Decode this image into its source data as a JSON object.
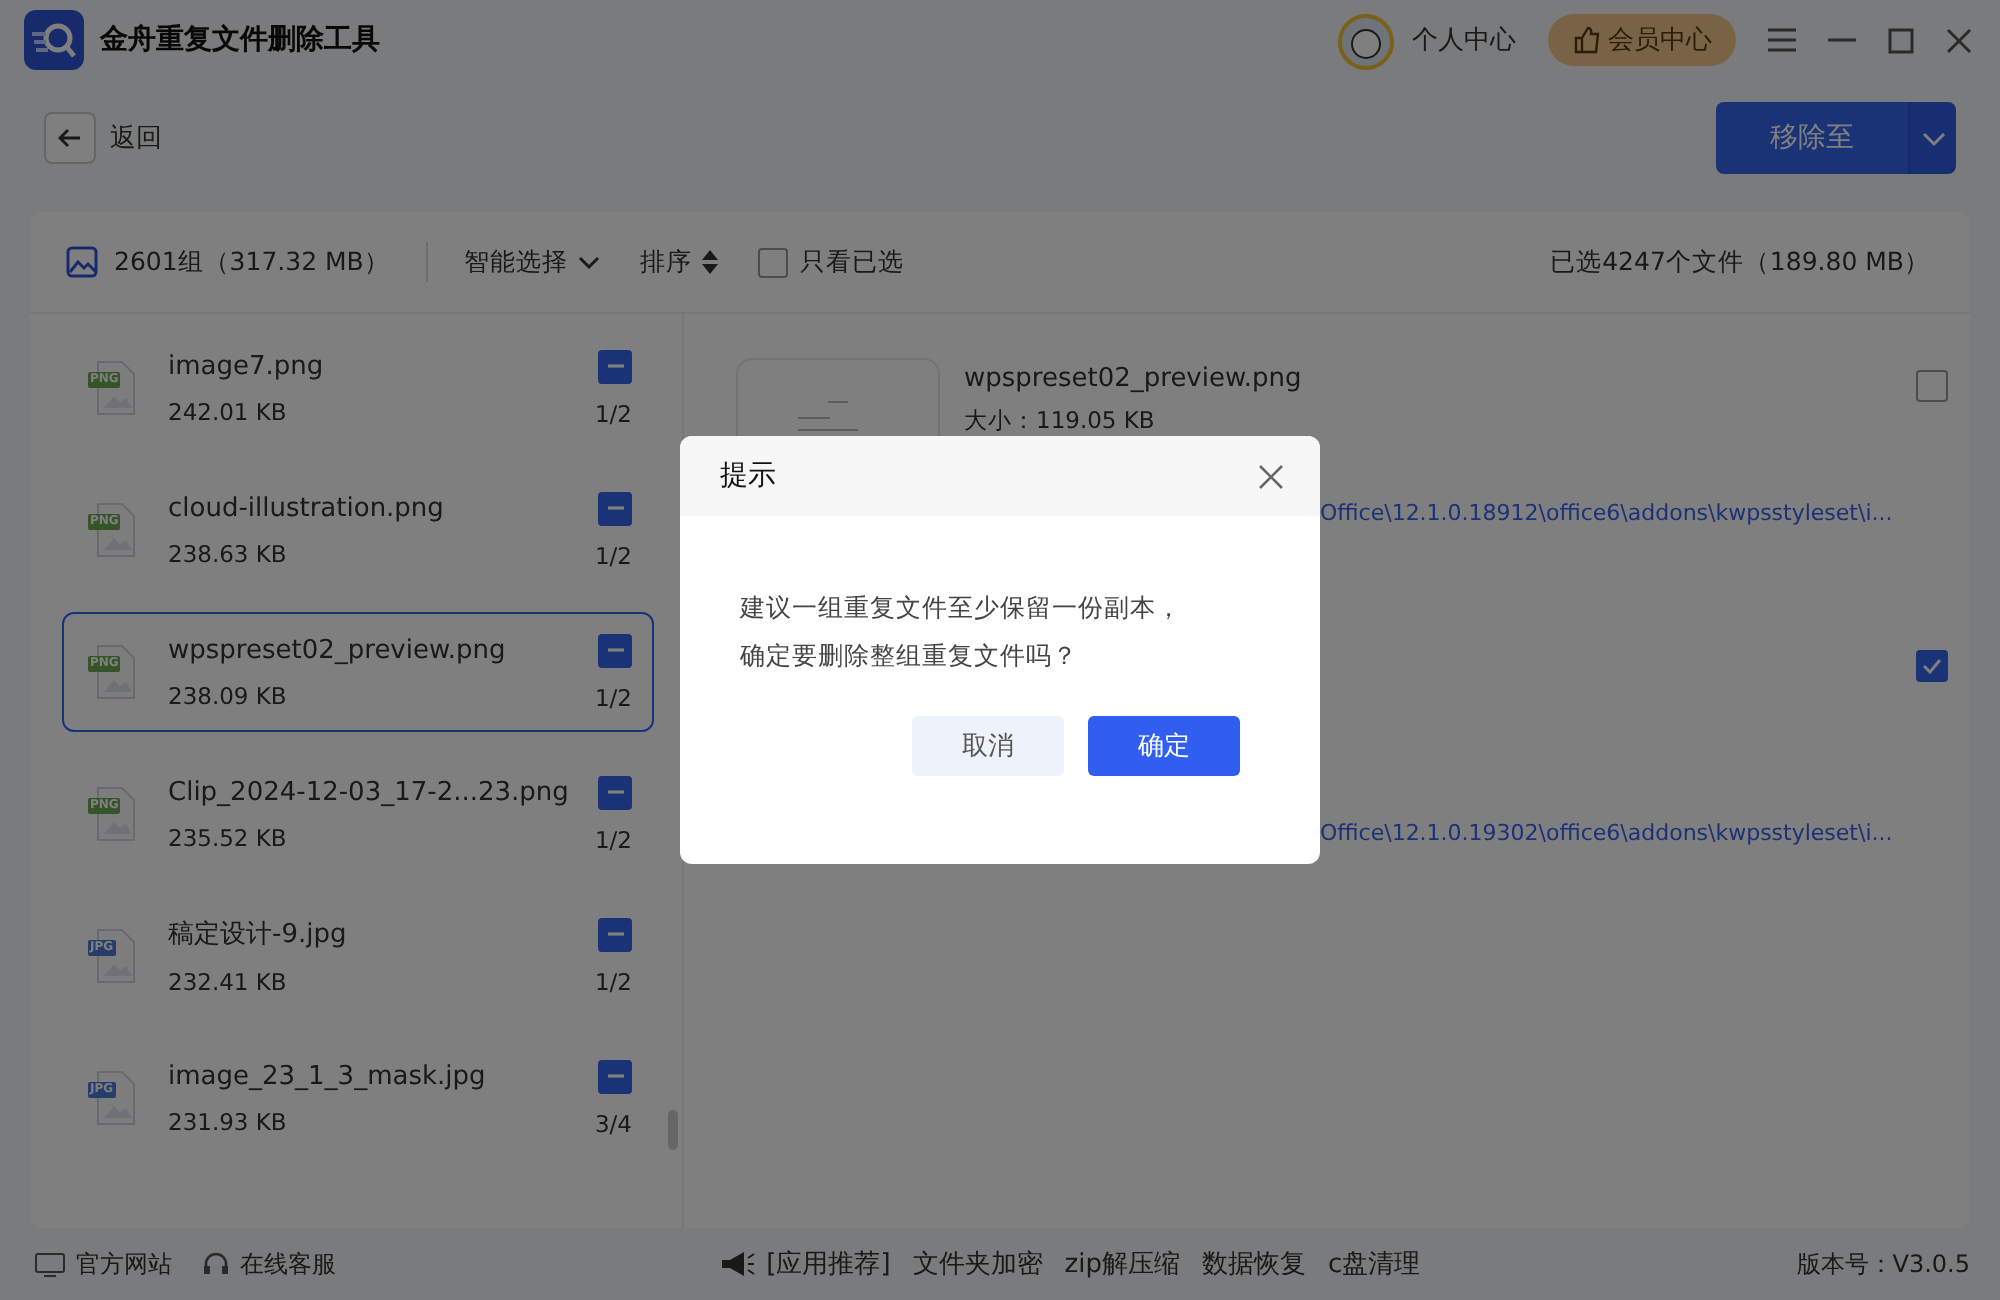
{
  "app": {
    "title": "金舟重复文件删除工具",
    "user_center": "个人中心",
    "vip_center": "会员中心"
  },
  "back": {
    "label": "返回"
  },
  "move_button": {
    "label": "移除至"
  },
  "toolbar": {
    "groups": "2601组（317.32 MB）",
    "smart_select": "智能选择",
    "sort": "排序",
    "only_selected": {
      "label": "只看已选",
      "checked": false
    },
    "selected_summary": "已选4247个文件（189.80 MB）"
  },
  "groups": [
    {
      "name": "image7.png",
      "size": "242.01 KB",
      "count": "1/2",
      "type": "PNG",
      "selected": false,
      "partially_checked": true
    },
    {
      "name": "cloud-illustration.png",
      "size": "238.63 KB",
      "count": "1/2",
      "type": "PNG",
      "selected": false,
      "partially_checked": true
    },
    {
      "name": "wpspreset02_preview.png",
      "size": "238.09 KB",
      "count": "1/2",
      "type": "PNG",
      "selected": true,
      "partially_checked": true
    },
    {
      "name": "Clip_2024-12-03_17-2...23.png",
      "size": "235.52 KB",
      "count": "1/2",
      "type": "PNG",
      "selected": false,
      "partially_checked": true
    },
    {
      "name": "稿定设计-9.jpg",
      "size": "232.41 KB",
      "count": "1/2",
      "type": "JPG",
      "selected": false,
      "partially_checked": true
    },
    {
      "name": "image_23_1_3_mask.jpg",
      "size": "231.93 KB",
      "count": "3/4",
      "type": "JPG",
      "selected": false,
      "partially_checked": true
    }
  ],
  "files": [
    {
      "name": "wpspreset02_preview.png",
      "size": "大小：119.05 KB",
      "path": "Office\\12.1.0.18912\\office6\\addons\\kwpsstyleset\\i...",
      "checked": false
    },
    {
      "path": "Office\\12.1.0.19302\\office6\\addons\\kwpsstyleset\\i...",
      "checked": true
    }
  ],
  "dialog": {
    "title": "提示",
    "message": [
      "建议一组重复文件至少保留一份副本，",
      "确定要删除整组重复文件吗？"
    ],
    "cancel": "取消",
    "confirm": "确定"
  },
  "footer": {
    "links": [
      "官方网站",
      "在线客服"
    ],
    "recommend": "[应用推荐]",
    "apps": [
      "文件夹加密",
      "zip解压缩",
      "数据恢复",
      "c盘清理"
    ],
    "version": "版本号：V3.0.5"
  }
}
